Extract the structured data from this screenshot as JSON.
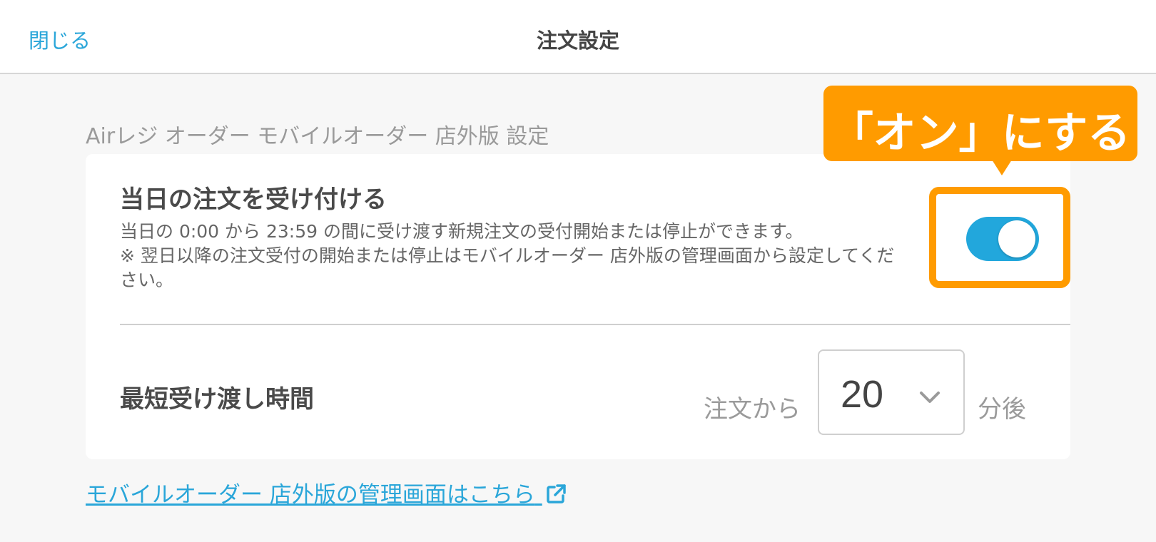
{
  "header": {
    "close_label": "閉じる",
    "title": "注文設定"
  },
  "section": {
    "title": "Airレジ オーダー モバイルオーダー 店外版 設定"
  },
  "same_day": {
    "title": "当日の注文を受け付ける",
    "description": "当日の 0:00 から 23:59 の間に受け渡す新規注文の受付開始または停止ができます。\n※ 翌日以降の注文受付の開始または停止はモバイルオーダー 店外版の管理画面から設定してください。",
    "toggle_state": "on",
    "toggle_color": "#22a7dc"
  },
  "pickup": {
    "title": "最短受け渡し時間",
    "prefix": "注文から",
    "value": "20",
    "suffix": "分後"
  },
  "admin_link": {
    "label": "モバイルオーダー 店外版の管理画面はこちら",
    "icon": "external-link-icon"
  },
  "annotation": {
    "callout_text": "「オン」にする",
    "color": "#ff9b00"
  }
}
